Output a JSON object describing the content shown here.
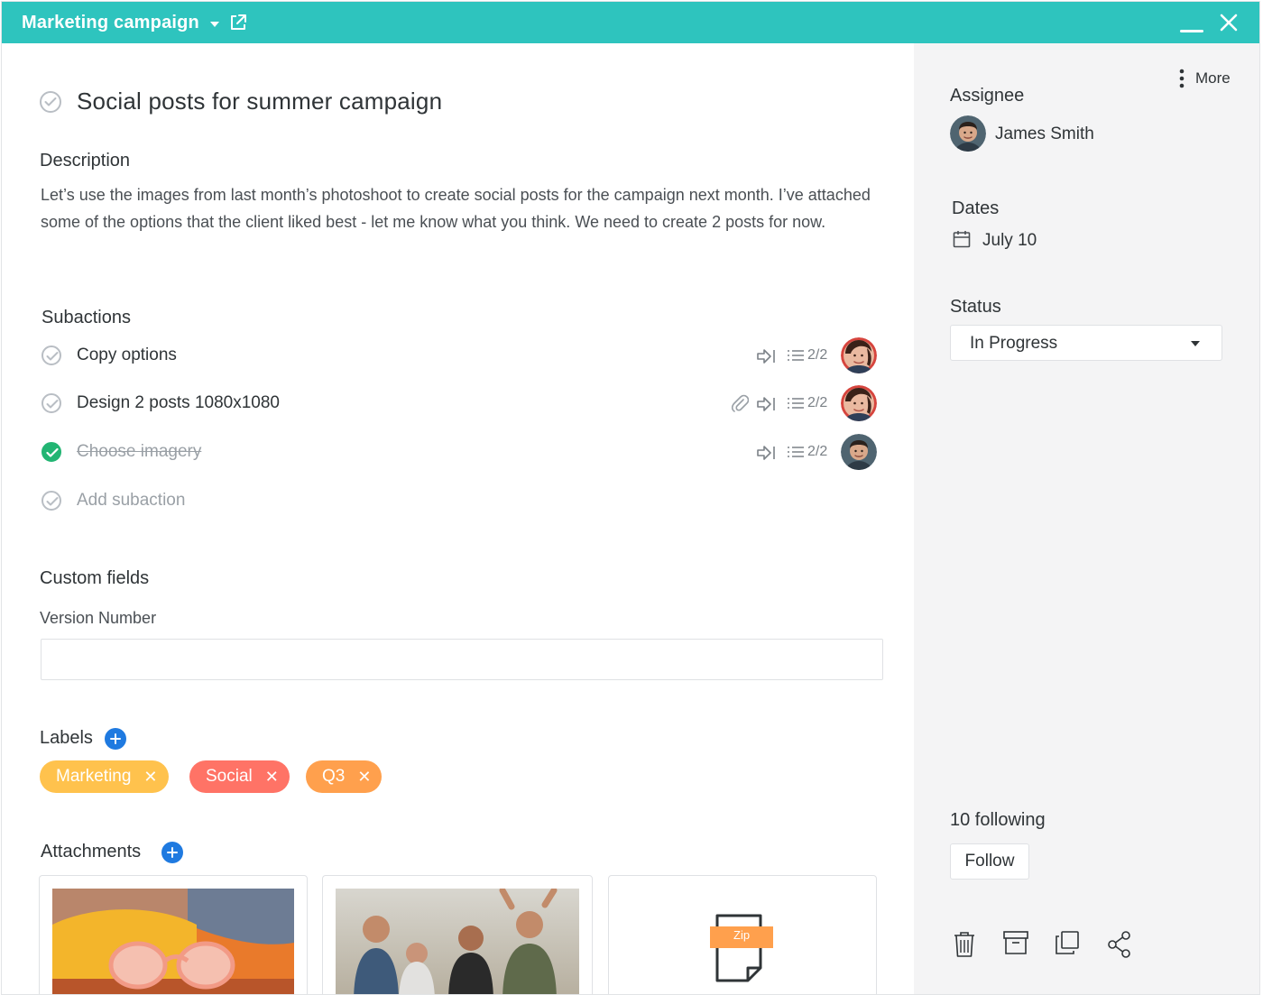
{
  "topbar": {
    "project_title": "Marketing campaign"
  },
  "task": {
    "title": "Social posts for summer campaign",
    "description_heading": "Description",
    "description": "Let’s use the images from last month’s photoshoot to create social posts for the campaign next month. I’ve attached some of the options that the client liked best - let me know what you think. We need to create 2 posts for now."
  },
  "subactions": {
    "heading": "Subactions",
    "items": [
      {
        "label": "Copy options",
        "count": "2/2",
        "done": false,
        "attachment": false
      },
      {
        "label": "Design 2 posts 1080x1080",
        "count": "2/2",
        "done": false,
        "attachment": true
      },
      {
        "label": "Choose imagery",
        "count": "2/2",
        "done": true,
        "attachment": false
      }
    ],
    "add_label": "Add subaction"
  },
  "custom_fields": {
    "heading": "Custom fields",
    "version_label": "Version Number",
    "version_value": ""
  },
  "labels": {
    "heading": "Labels",
    "items": [
      {
        "text": "Marketing",
        "color": "#ffc24d"
      },
      {
        "text": "Social",
        "color": "#ff7366"
      },
      {
        "text": "Q3",
        "color": "#ffa04d"
      }
    ]
  },
  "attachments": {
    "heading": "Attachments",
    "zip_label": "Zip"
  },
  "sidebar": {
    "more_label": "More",
    "assignee_heading": "Assignee",
    "assignee_name": "James Smith",
    "dates_heading": "Dates",
    "date_value": "July 10",
    "status_heading": "Status",
    "status_value": "In Progress",
    "following_text": "10 following",
    "follow_label": "Follow"
  },
  "colors": {
    "accent": "#2ec4be",
    "success": "#22b573",
    "link_blue": "#1f7ae0"
  }
}
